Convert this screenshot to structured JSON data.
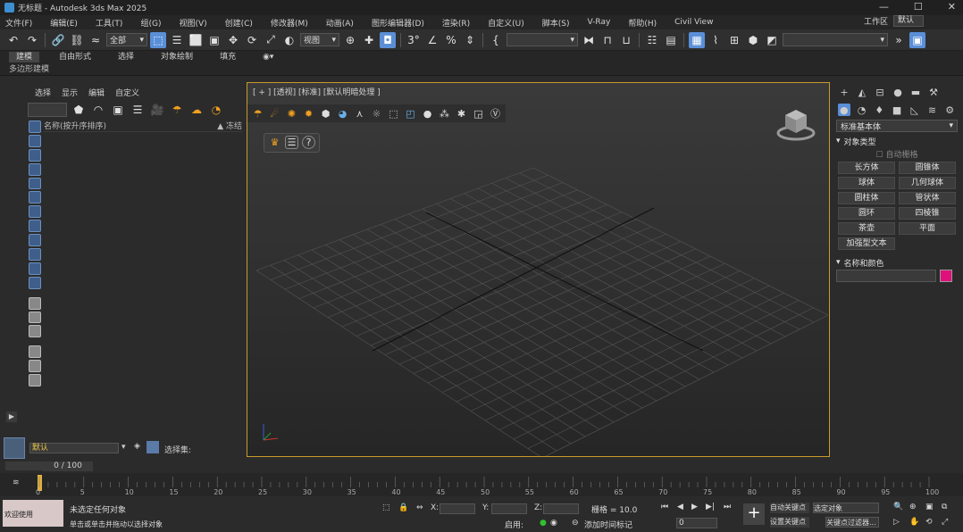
{
  "titlebar": {
    "title": "无标题 - Autodesk 3ds Max 2025",
    "min": "—",
    "max": "☐",
    "close": "✕"
  },
  "menu": {
    "items": [
      "文件(F)",
      "编辑(E)",
      "工具(T)",
      "组(G)",
      "视图(V)",
      "创建(C)",
      "修改器(M)",
      "动画(A)",
      "图形编辑器(D)",
      "渲染(R)",
      "自定义(U)",
      "脚本(S)",
      "V-Ray",
      "帮助(H)",
      "Civil View"
    ],
    "workspace_label": "工作区",
    "workspace_value": "默认"
  },
  "toolbar": {
    "selection_filter": "全部",
    "ref_coord": "视图",
    "named_sel": "",
    "percent": "%"
  },
  "ribbon": {
    "tabs": [
      "建模",
      "自由形式",
      "选择",
      "对象绘制",
      "填充"
    ],
    "active": "建模",
    "sub": "多边形建模"
  },
  "scene_explorer": {
    "tabs": [
      "选择",
      "显示",
      "编辑",
      "自定义"
    ],
    "col_name": "名称(按升序排序)",
    "col_frozen": "▲ 冻结",
    "layer_value": "默认",
    "layer_label": "选择集:"
  },
  "viewport": {
    "label": "[ + ] [透视] [标准] [默认明暗处理 ]"
  },
  "command_panel": {
    "category": "标准基本体",
    "object_type_title": "对象类型",
    "autogrid": "自动栅格",
    "buttons": [
      "长方体",
      "圆锥体",
      "球体",
      "几何球体",
      "圆柱体",
      "管状体",
      "圆环",
      "四棱锥",
      "茶壶",
      "平面",
      "加强型文本"
    ],
    "name_color_title": "名称和颜色",
    "swatch_color": "#e0107a"
  },
  "timeline": {
    "frame_display": "0 / 100",
    "ticks": [
      "0",
      "5",
      "10",
      "15",
      "20",
      "25",
      "30",
      "35",
      "40",
      "45",
      "50",
      "55",
      "60",
      "65",
      "70",
      "75",
      "80",
      "85",
      "90",
      "95",
      "100"
    ]
  },
  "status": {
    "maxscript": "欢迎使用 MAXScript。",
    "sel_info": "未选定任何对象",
    "hint": "单击或单击并拖动以选择对象",
    "x_label": "X:",
    "y_label": "Y:",
    "z_label": "Z:",
    "grid": "栅格 = 10.0",
    "addtime": "添加时间标记",
    "autokey": "自动关键点",
    "setkey": "设置关键点",
    "key_filter": "关键点过滤器...",
    "selected": "选定对象",
    "enabled": "启用:",
    "frame": "0"
  }
}
